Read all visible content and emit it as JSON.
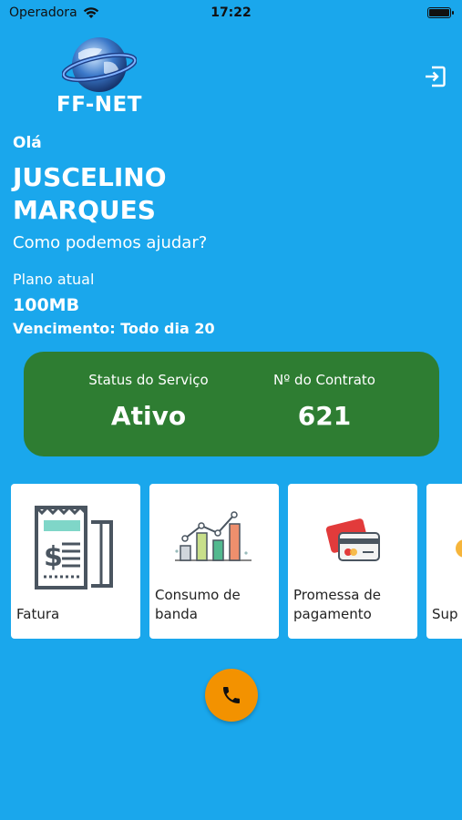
{
  "status_bar": {
    "carrier": "Operadora",
    "time": "17:22"
  },
  "brand": {
    "logo_text": "FF-NET"
  },
  "greeting": {
    "hello": "Olá",
    "name": "JUSCELINO MARQUES",
    "help": "Como podemos ajudar?"
  },
  "plan": {
    "label": "Plano atual",
    "value": "100MB",
    "due": "Vencimento: Todo dia 20"
  },
  "service_card": {
    "status_label": "Status do Serviço",
    "status_value": "Ativo",
    "contract_label": "Nº do Contrato",
    "contract_value": "621",
    "color": "#2e7d32"
  },
  "tiles": [
    {
      "label": "Fatura",
      "icon": "invoice-icon"
    },
    {
      "label": "Consumo de banda",
      "icon": "bandwidth-chart-icon"
    },
    {
      "label": "Promessa de pagamento",
      "icon": "credit-card-icon"
    },
    {
      "label": "Sup",
      "icon": "support-icon"
    }
  ],
  "colors": {
    "background": "#1aa7ec",
    "call_button": "#f39200"
  }
}
